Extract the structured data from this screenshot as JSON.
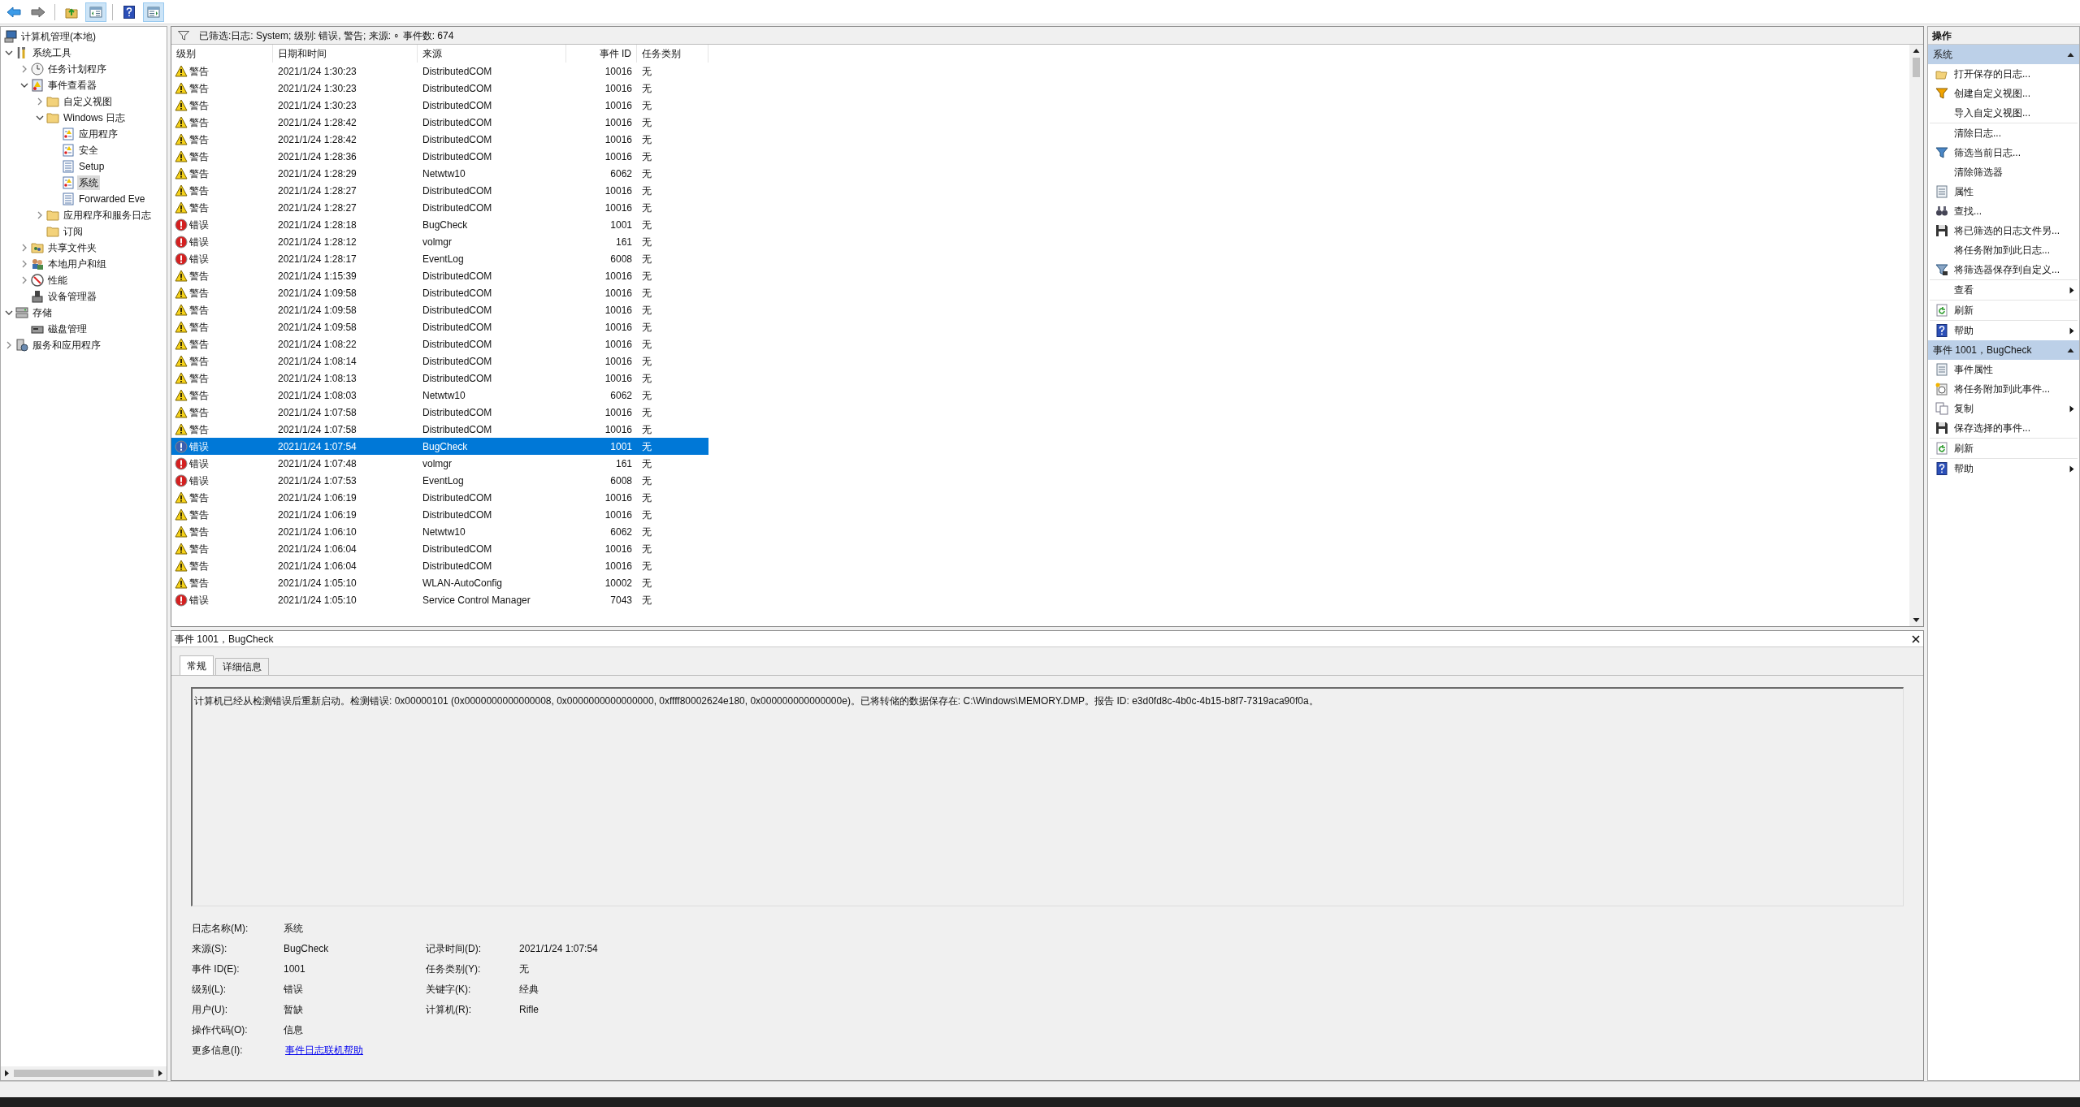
{
  "toolbar": [
    {
      "kind": "back",
      "pressed": false
    },
    {
      "kind": "forward",
      "pressed": false
    },
    {
      "kind": "up",
      "pressed": false
    },
    {
      "kind": "tree",
      "pressed": true
    },
    {
      "kind": "help",
      "pressed": false
    },
    {
      "kind": "pane",
      "pressed": true
    }
  ],
  "tree": [
    {
      "label": "计算机管理(本地)",
      "kind": "computer",
      "selected": false,
      "children": [
        {
          "label": "系统工具",
          "kind": "tools",
          "selected": false,
          "expanded": true,
          "children": [
            {
              "label": "任务计划程序",
              "kind": "clock",
              "selected": false,
              "expanded": false
            },
            {
              "label": "事件查看器",
              "kind": "viewer",
              "selected": false,
              "expanded": true,
              "children": [
                {
                  "label": "自定义视图",
                  "kind": "folder",
                  "selected": false,
                  "expanded": false
                },
                {
                  "label": "Windows 日志",
                  "kind": "folder",
                  "selected": false,
                  "expanded": true,
                  "children": [
                    {
                      "label": "应用程序",
                      "kind": "log",
                      "selected": false
                    },
                    {
                      "label": "安全",
                      "kind": "log",
                      "selected": false
                    },
                    {
                      "label": "Setup",
                      "kind": "page",
                      "selected": false
                    },
                    {
                      "label": "系统",
                      "kind": "log",
                      "selected": true
                    },
                    {
                      "label": "Forwarded Eve",
                      "kind": "page",
                      "selected": false
                    }
                  ]
                },
                {
                  "label": "应用程序和服务日志",
                  "kind": "folder",
                  "selected": false,
                  "expanded": false
                },
                {
                  "label": "订阅",
                  "kind": "folder",
                  "selected": false
                }
              ]
            },
            {
              "label": "共享文件夹",
              "kind": "share",
              "selected": false,
              "expanded": false
            },
            {
              "label": "本地用户和组",
              "kind": "users",
              "selected": false,
              "expanded": false
            },
            {
              "label": "性能",
              "kind": "perf",
              "selected": false,
              "expanded": false
            },
            {
              "label": "设备管理器",
              "kind": "device",
              "selected": false
            }
          ]
        },
        {
          "label": "存储",
          "kind": "storage",
          "selected": false,
          "expanded": true,
          "children": [
            {
              "label": "磁盘管理",
              "kind": "disk",
              "selected": false
            }
          ]
        },
        {
          "label": "服务和应用程序",
          "kind": "services",
          "selected": false,
          "expanded": false
        }
      ]
    }
  ],
  "filter_bar": {
    "text": "已筛选:日志: System; 级别: 错误, 警告; 来源: ∘ 事件数: 674"
  },
  "table": {
    "columns": [
      "级别",
      "日期和时间",
      "来源",
      "事件 ID",
      "任务类别"
    ],
    "rows": [
      {
        "kind": "warning",
        "severity": "警告",
        "datetime": "2021/1/24 1:30:23",
        "source": "DistributedCOM",
        "event_id": "10016",
        "task": "无",
        "selected": false
      },
      {
        "kind": "warning",
        "severity": "警告",
        "datetime": "2021/1/24 1:30:23",
        "source": "DistributedCOM",
        "event_id": "10016",
        "task": "无",
        "selected": false
      },
      {
        "kind": "warning",
        "severity": "警告",
        "datetime": "2021/1/24 1:30:23",
        "source": "DistributedCOM",
        "event_id": "10016",
        "task": "无",
        "selected": false
      },
      {
        "kind": "warning",
        "severity": "警告",
        "datetime": "2021/1/24 1:28:42",
        "source": "DistributedCOM",
        "event_id": "10016",
        "task": "无",
        "selected": false
      },
      {
        "kind": "warning",
        "severity": "警告",
        "datetime": "2021/1/24 1:28:42",
        "source": "DistributedCOM",
        "event_id": "10016",
        "task": "无",
        "selected": false
      },
      {
        "kind": "warning",
        "severity": "警告",
        "datetime": "2021/1/24 1:28:36",
        "source": "DistributedCOM",
        "event_id": "10016",
        "task": "无",
        "selected": false
      },
      {
        "kind": "warning",
        "severity": "警告",
        "datetime": "2021/1/24 1:28:29",
        "source": "Netwtw10",
        "event_id": "6062",
        "task": "无",
        "selected": false
      },
      {
        "kind": "warning",
        "severity": "警告",
        "datetime": "2021/1/24 1:28:27",
        "source": "DistributedCOM",
        "event_id": "10016",
        "task": "无",
        "selected": false
      },
      {
        "kind": "warning",
        "severity": "警告",
        "datetime": "2021/1/24 1:28:27",
        "source": "DistributedCOM",
        "event_id": "10016",
        "task": "无",
        "selected": false
      },
      {
        "kind": "error",
        "severity": "错误",
        "datetime": "2021/1/24 1:28:18",
        "source": "BugCheck",
        "event_id": "1001",
        "task": "无",
        "selected": false
      },
      {
        "kind": "error",
        "severity": "错误",
        "datetime": "2021/1/24 1:28:12",
        "source": "volmgr",
        "event_id": "161",
        "task": "无",
        "selected": false
      },
      {
        "kind": "error",
        "severity": "错误",
        "datetime": "2021/1/24 1:28:17",
        "source": "EventLog",
        "event_id": "6008",
        "task": "无",
        "selected": false
      },
      {
        "kind": "warning",
        "severity": "警告",
        "datetime": "2021/1/24 1:15:39",
        "source": "DistributedCOM",
        "event_id": "10016",
        "task": "无",
        "selected": false
      },
      {
        "kind": "warning",
        "severity": "警告",
        "datetime": "2021/1/24 1:09:58",
        "source": "DistributedCOM",
        "event_id": "10016",
        "task": "无",
        "selected": false
      },
      {
        "kind": "warning",
        "severity": "警告",
        "datetime": "2021/1/24 1:09:58",
        "source": "DistributedCOM",
        "event_id": "10016",
        "task": "无",
        "selected": false
      },
      {
        "kind": "warning",
        "severity": "警告",
        "datetime": "2021/1/24 1:09:58",
        "source": "DistributedCOM",
        "event_id": "10016",
        "task": "无",
        "selected": false
      },
      {
        "kind": "warning",
        "severity": "警告",
        "datetime": "2021/1/24 1:08:22",
        "source": "DistributedCOM",
        "event_id": "10016",
        "task": "无",
        "selected": false
      },
      {
        "kind": "warning",
        "severity": "警告",
        "datetime": "2021/1/24 1:08:14",
        "source": "DistributedCOM",
        "event_id": "10016",
        "task": "无",
        "selected": false
      },
      {
        "kind": "warning",
        "severity": "警告",
        "datetime": "2021/1/24 1:08:13",
        "source": "DistributedCOM",
        "event_id": "10016",
        "task": "无",
        "selected": false
      },
      {
        "kind": "warning",
        "severity": "警告",
        "datetime": "2021/1/24 1:08:03",
        "source": "Netwtw10",
        "event_id": "6062",
        "task": "无",
        "selected": false
      },
      {
        "kind": "warning",
        "severity": "警告",
        "datetime": "2021/1/24 1:07:58",
        "source": "DistributedCOM",
        "event_id": "10016",
        "task": "无",
        "selected": false
      },
      {
        "kind": "warning",
        "severity": "警告",
        "datetime": "2021/1/24 1:07:58",
        "source": "DistributedCOM",
        "event_id": "10016",
        "task": "无",
        "selected": false
      },
      {
        "kind": "error",
        "severity": "错误",
        "datetime": "2021/1/24 1:07:54",
        "source": "BugCheck",
        "event_id": "1001",
        "task": "无",
        "selected": true
      },
      {
        "kind": "error",
        "severity": "错误",
        "datetime": "2021/1/24 1:07:48",
        "source": "volmgr",
        "event_id": "161",
        "task": "无",
        "selected": false
      },
      {
        "kind": "error",
        "severity": "错误",
        "datetime": "2021/1/24 1:07:53",
        "source": "EventLog",
        "event_id": "6008",
        "task": "无",
        "selected": false
      },
      {
        "kind": "warning",
        "severity": "警告",
        "datetime": "2021/1/24 1:06:19",
        "source": "DistributedCOM",
        "event_id": "10016",
        "task": "无",
        "selected": false
      },
      {
        "kind": "warning",
        "severity": "警告",
        "datetime": "2021/1/24 1:06:19",
        "source": "DistributedCOM",
        "event_id": "10016",
        "task": "无",
        "selected": false
      },
      {
        "kind": "warning",
        "severity": "警告",
        "datetime": "2021/1/24 1:06:10",
        "source": "Netwtw10",
        "event_id": "6062",
        "task": "无",
        "selected": false
      },
      {
        "kind": "warning",
        "severity": "警告",
        "datetime": "2021/1/24 1:06:04",
        "source": "DistributedCOM",
        "event_id": "10016",
        "task": "无",
        "selected": false
      },
      {
        "kind": "warning",
        "severity": "警告",
        "datetime": "2021/1/24 1:06:04",
        "source": "DistributedCOM",
        "event_id": "10016",
        "task": "无",
        "selected": false
      },
      {
        "kind": "warning",
        "severity": "警告",
        "datetime": "2021/1/24 1:05:10",
        "source": "WLAN-AutoConfig",
        "event_id": "10002",
        "task": "无",
        "selected": false
      },
      {
        "kind": "error",
        "severity": "错误",
        "datetime": "2021/1/24 1:05:10",
        "source": "Service Control Manager",
        "event_id": "7043",
        "task": "无",
        "selected": false
      }
    ]
  },
  "details": {
    "title": "事件 1001，BugCheck",
    "tabs": [
      {
        "label": "常规",
        "selected": true
      },
      {
        "label": "详细信息",
        "selected": false
      }
    ],
    "message": "计算机已经从检测错误后重新启动。检测错误: 0x00000101 (0x0000000000000008, 0x0000000000000000, 0xffff80002624e180, 0x000000000000000e)。已将转储的数据保存在: C:\\Windows\\MEMORY.DMP。报告 ID: e3d0fd8c-4b0c-4b15-b8f7-7319aca90f0a。",
    "field_rows": [
      [
        {
          "label": "日志名称(M):",
          "value": "系统",
          "link": false
        }
      ],
      [
        {
          "label": "来源(S):",
          "value": "BugCheck",
          "link": false
        },
        {
          "label": "记录时间(D):",
          "value": "2021/1/24 1:07:54",
          "link": false
        }
      ],
      [
        {
          "label": "事件 ID(E):",
          "value": "1001",
          "link": false
        },
        {
          "label": "任务类别(Y):",
          "value": "无",
          "link": false
        }
      ],
      [
        {
          "label": "级别(L):",
          "value": "错误",
          "link": false
        },
        {
          "label": "关键字(K):",
          "value": "经典",
          "link": false
        }
      ],
      [
        {
          "label": "用户(U):",
          "value": "暂缺",
          "link": false
        },
        {
          "label": "计算机(R):",
          "value": "Rifle",
          "link": false
        }
      ],
      [
        {
          "label": "操作代码(O):",
          "value": "信息",
          "link": false
        }
      ],
      [
        {
          "label": "更多信息(I):",
          "value": "事件日志联机帮助",
          "link": true
        }
      ]
    ]
  },
  "actions": {
    "title": "操作",
    "sections": [
      {
        "title": "系统",
        "expanded": true,
        "groups": [
          [
            {
              "label": "打开保存的日志...",
              "kind": "folder",
              "submenu": false
            },
            {
              "label": "创建自定义视图...",
              "kind": "filter_color",
              "submenu": false
            },
            {
              "label": "导入自定义视图...",
              "kind": "none",
              "submenu": false
            }
          ],
          [
            {
              "label": "清除日志...",
              "kind": "none",
              "submenu": false
            },
            {
              "label": "筛选当前日志...",
              "kind": "filter",
              "submenu": false
            },
            {
              "label": "清除筛选器",
              "kind": "none",
              "submenu": false
            },
            {
              "label": "属性",
              "kind": "properties",
              "submenu": false
            },
            {
              "label": "查找...",
              "kind": "find",
              "submenu": false
            },
            {
              "label": "将已筛选的日志文件另...",
              "kind": "save",
              "submenu": false
            },
            {
              "label": "将任务附加到此日志...",
              "kind": "none",
              "submenu": false
            },
            {
              "label": "将筛选器保存到自定义...",
              "kind": "filter_save",
              "submenu": false
            }
          ],
          [
            {
              "label": "查看",
              "kind": "none",
              "submenu": true
            }
          ],
          [
            {
              "label": "刷新",
              "kind": "refresh",
              "submenu": false
            }
          ],
          [
            {
              "label": "帮助",
              "kind": "help",
              "submenu": true
            }
          ]
        ]
      },
      {
        "title": "事件 1001，BugCheck",
        "expanded": true,
        "groups": [
          [
            {
              "label": "事件属性",
              "kind": "properties",
              "submenu": false
            },
            {
              "label": "将任务附加到此事件...",
              "kind": "task",
              "submenu": false
            },
            {
              "label": "复制",
              "kind": "copy",
              "submenu": true
            },
            {
              "label": "保存选择的事件...",
              "kind": "save",
              "submenu": false
            }
          ],
          [
            {
              "label": "刷新",
              "kind": "refresh",
              "submenu": false
            }
          ],
          [
            {
              "label": "帮助",
              "kind": "help",
              "submenu": true
            }
          ]
        ]
      }
    ]
  }
}
